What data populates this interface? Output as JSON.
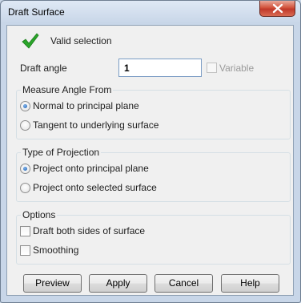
{
  "window": {
    "title": "Draft Surface"
  },
  "status": {
    "icon": "checkmark-icon",
    "color": "#2aa52a",
    "text": "Valid selection"
  },
  "draft_angle": {
    "label": "Draft angle",
    "value": "1",
    "variable_label": "Variable",
    "variable_checked": false,
    "variable_enabled": false
  },
  "measure_angle_from": {
    "title": "Measure Angle From",
    "options": [
      {
        "label": "Normal to principal plane",
        "selected": true
      },
      {
        "label": "Tangent to underlying surface",
        "selected": false
      }
    ]
  },
  "type_of_projection": {
    "title": "Type of Projection",
    "options": [
      {
        "label": "Project onto principal plane",
        "selected": true
      },
      {
        "label": "Project onto selected surface",
        "selected": false
      }
    ]
  },
  "options": {
    "title": "Options",
    "items": [
      {
        "label": "Draft both sides of surface",
        "checked": false
      },
      {
        "label": "Smoothing",
        "checked": false
      }
    ]
  },
  "buttons": {
    "preview": "Preview",
    "apply": "Apply",
    "cancel": "Cancel",
    "help": "Help"
  }
}
